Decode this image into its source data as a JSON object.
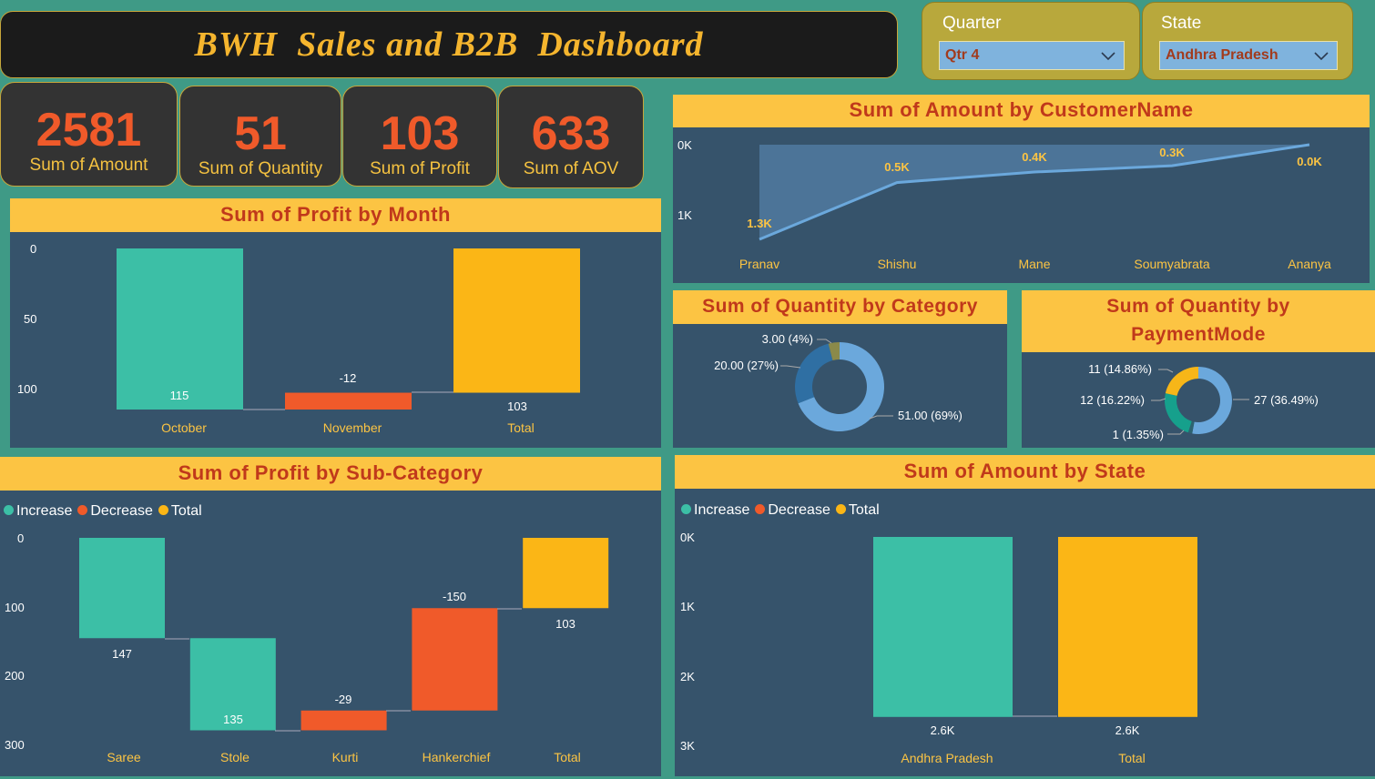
{
  "dashboard": {
    "title": "BWH  Sales and B2B  Dashboard"
  },
  "slicers": {
    "quarter": {
      "label": "Quarter",
      "value": "Qtr 4"
    },
    "state": {
      "label": "State",
      "value": "Andhra Pradesh"
    }
  },
  "kpis": [
    {
      "value": "2581",
      "label": "Sum of Amount"
    },
    {
      "value": "51",
      "label": "Sum of Quantity"
    },
    {
      "value": "103",
      "label": "Sum of Profit"
    },
    {
      "value": "633",
      "label": "Sum of AOV"
    }
  ],
  "legend": {
    "increase": "Increase",
    "decrease": "Decrease",
    "total": "Total"
  },
  "colors": {
    "increase": "#3cbfa6",
    "decrease": "#f05a2a",
    "total": "#fbb616",
    "blue": "#6ba8dc",
    "header": "#fcc443",
    "panel": "#36536b"
  },
  "chart_data": [
    {
      "id": "profit-by-month",
      "type": "bar",
      "subtype": "waterfall",
      "title": "Sum of Profit by Month",
      "categories": [
        "October",
        "November",
        "Total"
      ],
      "values": [
        115,
        -12,
        103
      ],
      "value_labels": [
        "115",
        "-12",
        "103"
      ],
      "kinds": [
        "increase",
        "decrease",
        "total"
      ],
      "yticks": [
        "0",
        "50",
        "100"
      ],
      "ylim": [
        0,
        115
      ],
      "axis": "inverted"
    },
    {
      "id": "amount-by-customer",
      "type": "area",
      "title": "Sum of Amount by CustomerName",
      "categories": [
        "Pranav",
        "Shishu",
        "Mane",
        "Soumyabrata",
        "Ananya"
      ],
      "values": [
        1.35,
        0.54,
        0.39,
        0.3,
        0.0
      ],
      "value_labels": [
        "1.3K",
        "0.5K",
        "0.4K",
        "0.3K",
        "0.0K"
      ],
      "yticks": [
        "0K",
        "1K"
      ],
      "ylim": [
        0,
        1.35
      ],
      "axis": "inverted"
    },
    {
      "id": "quantity-by-category",
      "type": "pie",
      "subtype": "donut",
      "title": "Sum of Quantity by Category",
      "values": [
        51,
        20,
        3
      ],
      "labels": [
        "51.00 (69%)",
        "20.00 (27%)",
        "3.00 (4%)"
      ],
      "colors": [
        "#6ba8dc",
        "#2f6fa3",
        "#8b8a4a"
      ]
    },
    {
      "id": "quantity-by-paymentmode",
      "type": "pie",
      "subtype": "donut",
      "title": "Sum of Quantity by PaymentMode",
      "values": [
        27,
        1,
        12,
        11
      ],
      "labels": [
        "27 (36.49%)",
        "1 (1.35%)",
        "12 (16.22%)",
        "11 (14.86%)"
      ],
      "colors": [
        "#6ba8dc",
        "#2d6370",
        "#16a08c",
        "#f7b618"
      ]
    },
    {
      "id": "profit-by-subcategory",
      "type": "bar",
      "subtype": "waterfall",
      "title": "Sum of Profit by Sub-Category",
      "categories": [
        "Saree",
        "Stole",
        "Kurti",
        "Hankerchief",
        "Total"
      ],
      "values": [
        147,
        135,
        -29,
        -150,
        103
      ],
      "value_labels": [
        "147",
        "135",
        "-29",
        "-150",
        "103"
      ],
      "kinds": [
        "increase",
        "increase",
        "decrease",
        "decrease",
        "total"
      ],
      "yticks": [
        "0",
        "100",
        "200",
        "300"
      ],
      "ylim": [
        0,
        300
      ],
      "axis": "inverted"
    },
    {
      "id": "amount-by-state",
      "type": "bar",
      "subtype": "waterfall",
      "title": "Sum of Amount by State",
      "categories": [
        "Andhra Pradesh",
        "Total"
      ],
      "values": [
        2.58,
        2.58
      ],
      "value_labels": [
        "2.6K",
        "2.6K"
      ],
      "kinds": [
        "increase",
        "total"
      ],
      "yticks": [
        "0K",
        "1K",
        "2K",
        "3K"
      ],
      "ylim": [
        0,
        3
      ],
      "axis": "inverted"
    }
  ]
}
